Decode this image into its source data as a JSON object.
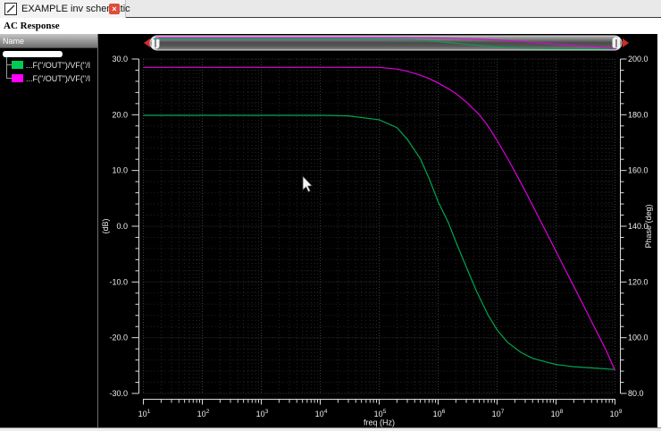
{
  "window": {
    "tab_title": "EXAMPLE inv schematic",
    "title": "AC Response"
  },
  "icons": {
    "close": "×"
  },
  "sidebar": {
    "header": "Name",
    "entries": [
      {
        "label": "...F(\"/OUT\")/VF(\"/I",
        "color": "#00cc55"
      },
      {
        "label": "...F(\"/OUT\")/VF(\"/I",
        "color": "#ff00ff"
      }
    ]
  },
  "chart_data": {
    "type": "line",
    "title": "AC Response",
    "xlabel": "freq (Hz)",
    "x_scale": "log",
    "x_range_exponents": [
      1,
      9
    ],
    "x_tick_exponents": [
      1,
      2,
      3,
      4,
      5,
      6,
      7,
      8,
      9
    ],
    "grid": "dotted",
    "left_axis": {
      "label": "(dB)",
      "range": [
        -30,
        30
      ],
      "ticks": [
        30,
        20,
        10,
        0,
        -10,
        -20,
        -30
      ],
      "minor_step": 2
    },
    "right_axis": {
      "label": "Phase (deg)",
      "range": [
        80,
        200
      ],
      "ticks": [
        200,
        180,
        160,
        140,
        120,
        100,
        80
      ],
      "minor_step": 4
    },
    "series": [
      {
        "name": "...F(\"/OUT\")/VF(\"/I",
        "axis": "left",
        "color": "#00a551",
        "points": [
          [
            10,
            19.9
          ],
          [
            100,
            19.9
          ],
          [
            1000,
            19.9
          ],
          [
            10000,
            19.9
          ],
          [
            30000,
            19.8
          ],
          [
            100000,
            19.1
          ],
          [
            200000,
            17.7
          ],
          [
            300000,
            15.6
          ],
          [
            500000,
            12.1
          ],
          [
            700000,
            8.6
          ],
          [
            1000000,
            4.4
          ],
          [
            1500000,
            0.6
          ],
          [
            2000000,
            -2.8
          ],
          [
            3000000,
            -7.3
          ],
          [
            4500000,
            -11.7
          ],
          [
            7000000,
            -15.9
          ],
          [
            10000000,
            -18.6
          ],
          [
            15000000,
            -20.8
          ],
          [
            25000000,
            -22.6
          ],
          [
            40000000,
            -23.7
          ],
          [
            70000000,
            -24.4
          ],
          [
            100000000,
            -24.8
          ],
          [
            200000000,
            -25.2
          ],
          [
            500000000,
            -25.5
          ],
          [
            1000000000,
            -25.7
          ]
        ]
      },
      {
        "name": "...F(\"/OUT\")/VF(\"/I",
        "axis": "right",
        "color": "#dd00dd",
        "points": [
          [
            10,
            197
          ],
          [
            10000,
            197
          ],
          [
            100000,
            197
          ],
          [
            200000,
            196.4
          ],
          [
            300000,
            195.6
          ],
          [
            500000,
            194.2
          ],
          [
            700000,
            193
          ],
          [
            1000000,
            191.4
          ],
          [
            1500000,
            189.3
          ],
          [
            2000000,
            187.6
          ],
          [
            3000000,
            184.6
          ],
          [
            5000000,
            180
          ],
          [
            7000000,
            176
          ],
          [
            10000000,
            170.8
          ],
          [
            15000000,
            164.4
          ],
          [
            20000000,
            159.6
          ],
          [
            30000000,
            152.6
          ],
          [
            50000000,
            143.5
          ],
          [
            70000000,
            137.4
          ],
          [
            100000000,
            131
          ],
          [
            150000000,
            123.6
          ],
          [
            200000000,
            118.4
          ],
          [
            300000000,
            111.1
          ],
          [
            500000000,
            101.8
          ],
          [
            700000000,
            95.7
          ],
          [
            1000000000,
            88.2
          ]
        ]
      }
    ]
  }
}
